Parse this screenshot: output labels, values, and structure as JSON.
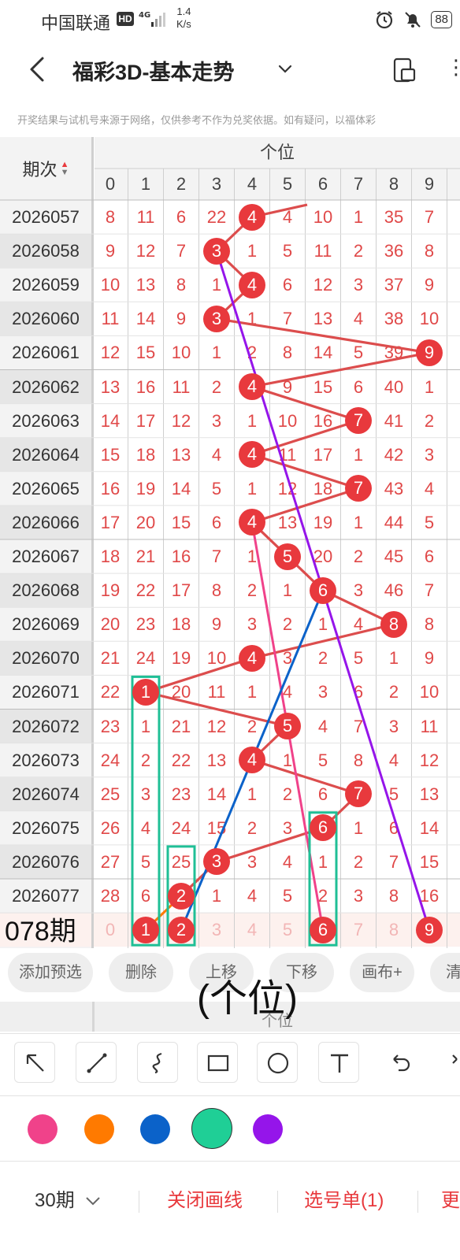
{
  "status_bar": {
    "carrier": "中国联通",
    "hd": "HD",
    "net": "4G",
    "speed_top": "1.4",
    "speed_bottom": "K/s",
    "battery": "88"
  },
  "nav": {
    "title": "福彩3D-基本走势",
    "more": "⋮"
  },
  "disclaimer": "开奖结果与试机号来源于网络，仅供参考不作为兑奖依据。如有疑问，以福体彩",
  "table": {
    "col_header_period": "期次",
    "col_header_group": "个位",
    "digits": [
      "0",
      "1",
      "2",
      "3",
      "4",
      "5",
      "6",
      "7",
      "8",
      "9"
    ],
    "rows": [
      {
        "period": "2026057",
        "values": [
          8,
          11,
          6,
          22,
          4,
          4,
          10,
          1,
          35,
          7
        ],
        "hit": 4
      },
      {
        "period": "2026058",
        "values": [
          9,
          12,
          7,
          3,
          1,
          5,
          11,
          2,
          36,
          8
        ],
        "hit": 3
      },
      {
        "period": "2026059",
        "values": [
          10,
          13,
          8,
          1,
          4,
          6,
          12,
          3,
          37,
          9
        ],
        "hit": 4
      },
      {
        "period": "2026060",
        "values": [
          11,
          14,
          9,
          3,
          1,
          7,
          13,
          4,
          38,
          10
        ],
        "hit": 3
      },
      {
        "period": "2026061",
        "values": [
          12,
          15,
          10,
          1,
          2,
          8,
          14,
          5,
          39,
          9
        ],
        "hit": 9
      },
      {
        "period": "2026062",
        "values": [
          13,
          16,
          11,
          2,
          4,
          9,
          15,
          6,
          40,
          1
        ],
        "hit": 4
      },
      {
        "period": "2026063",
        "values": [
          14,
          17,
          12,
          3,
          1,
          10,
          16,
          7,
          41,
          2
        ],
        "hit": 7
      },
      {
        "period": "2026064",
        "values": [
          15,
          18,
          13,
          4,
          4,
          11,
          17,
          1,
          42,
          3
        ],
        "hit": 4
      },
      {
        "period": "2026065",
        "values": [
          16,
          19,
          14,
          5,
          1,
          12,
          18,
          7,
          43,
          4
        ],
        "hit": 7
      },
      {
        "period": "2026066",
        "values": [
          17,
          20,
          15,
          6,
          4,
          13,
          19,
          1,
          44,
          5
        ],
        "hit": 4
      },
      {
        "period": "2026067",
        "values": [
          18,
          21,
          16,
          7,
          1,
          5,
          20,
          2,
          45,
          6
        ],
        "hit": 5
      },
      {
        "period": "2026068",
        "values": [
          19,
          22,
          17,
          8,
          2,
          1,
          6,
          3,
          46,
          7
        ],
        "hit": 6
      },
      {
        "period": "2026069",
        "values": [
          20,
          23,
          18,
          9,
          3,
          2,
          1,
          4,
          8,
          8
        ],
        "hit": 8
      },
      {
        "period": "2026070",
        "values": [
          21,
          24,
          19,
          10,
          4,
          3,
          2,
          5,
          1,
          9
        ],
        "hit": 4
      },
      {
        "period": "2026071",
        "values": [
          22,
          1,
          20,
          11,
          1,
          4,
          3,
          6,
          2,
          10
        ],
        "hit": 1
      },
      {
        "period": "2026072",
        "values": [
          23,
          1,
          21,
          12,
          2,
          5,
          4,
          7,
          3,
          11
        ],
        "hit": 5
      },
      {
        "period": "2026073",
        "values": [
          24,
          2,
          22,
          13,
          4,
          1,
          5,
          8,
          4,
          12
        ],
        "hit": 4
      },
      {
        "period": "2026074",
        "values": [
          25,
          3,
          23,
          14,
          1,
          2,
          6,
          7,
          5,
          13
        ],
        "hit": 7
      },
      {
        "period": "2026075",
        "values": [
          26,
          4,
          24,
          15,
          2,
          3,
          6,
          1,
          6,
          14
        ],
        "hit": 6
      },
      {
        "period": "2026076",
        "values": [
          27,
          5,
          25,
          3,
          3,
          4,
          1,
          2,
          7,
          15
        ],
        "hit": 3
      },
      {
        "period": "2026077",
        "values": [
          28,
          6,
          2,
          1,
          4,
          5,
          2,
          3,
          8,
          16
        ],
        "hit": 2
      }
    ],
    "prediction_label": "078期",
    "prediction_values": [
      "0",
      "1",
      "2",
      "3",
      "4",
      "5",
      "6",
      "7",
      "8",
      "9"
    ],
    "prediction_picks": [
      1,
      2,
      6,
      9
    ]
  },
  "actions": [
    "添加预选",
    "删除",
    "上移",
    "下移",
    "画布+",
    "清"
  ],
  "overlay_text": "(个位)",
  "strip_label": "个位",
  "tools": [
    "arrow-tool",
    "line-tool",
    "curve-tool",
    "rectangle-tool",
    "circle-tool",
    "text-tool",
    "undo-tool",
    "redo-tool"
  ],
  "palette": [
    "#f0428a",
    "#ff7a00",
    "#0b62c9",
    "#1fcf96",
    "#9515ea"
  ],
  "selected_color": "#1fcf96",
  "bottom_bar": {
    "periods": "30期",
    "close_lines": "关闭画线",
    "pick_list": "选号单(1)",
    "more": "更"
  },
  "colors": {
    "hit_ball": "#e8393d",
    "hit_line": "#dc4d4d",
    "count_text": "#e04848",
    "grid_line": "#cfcfcf",
    "accent_green": "#1fbf96"
  }
}
